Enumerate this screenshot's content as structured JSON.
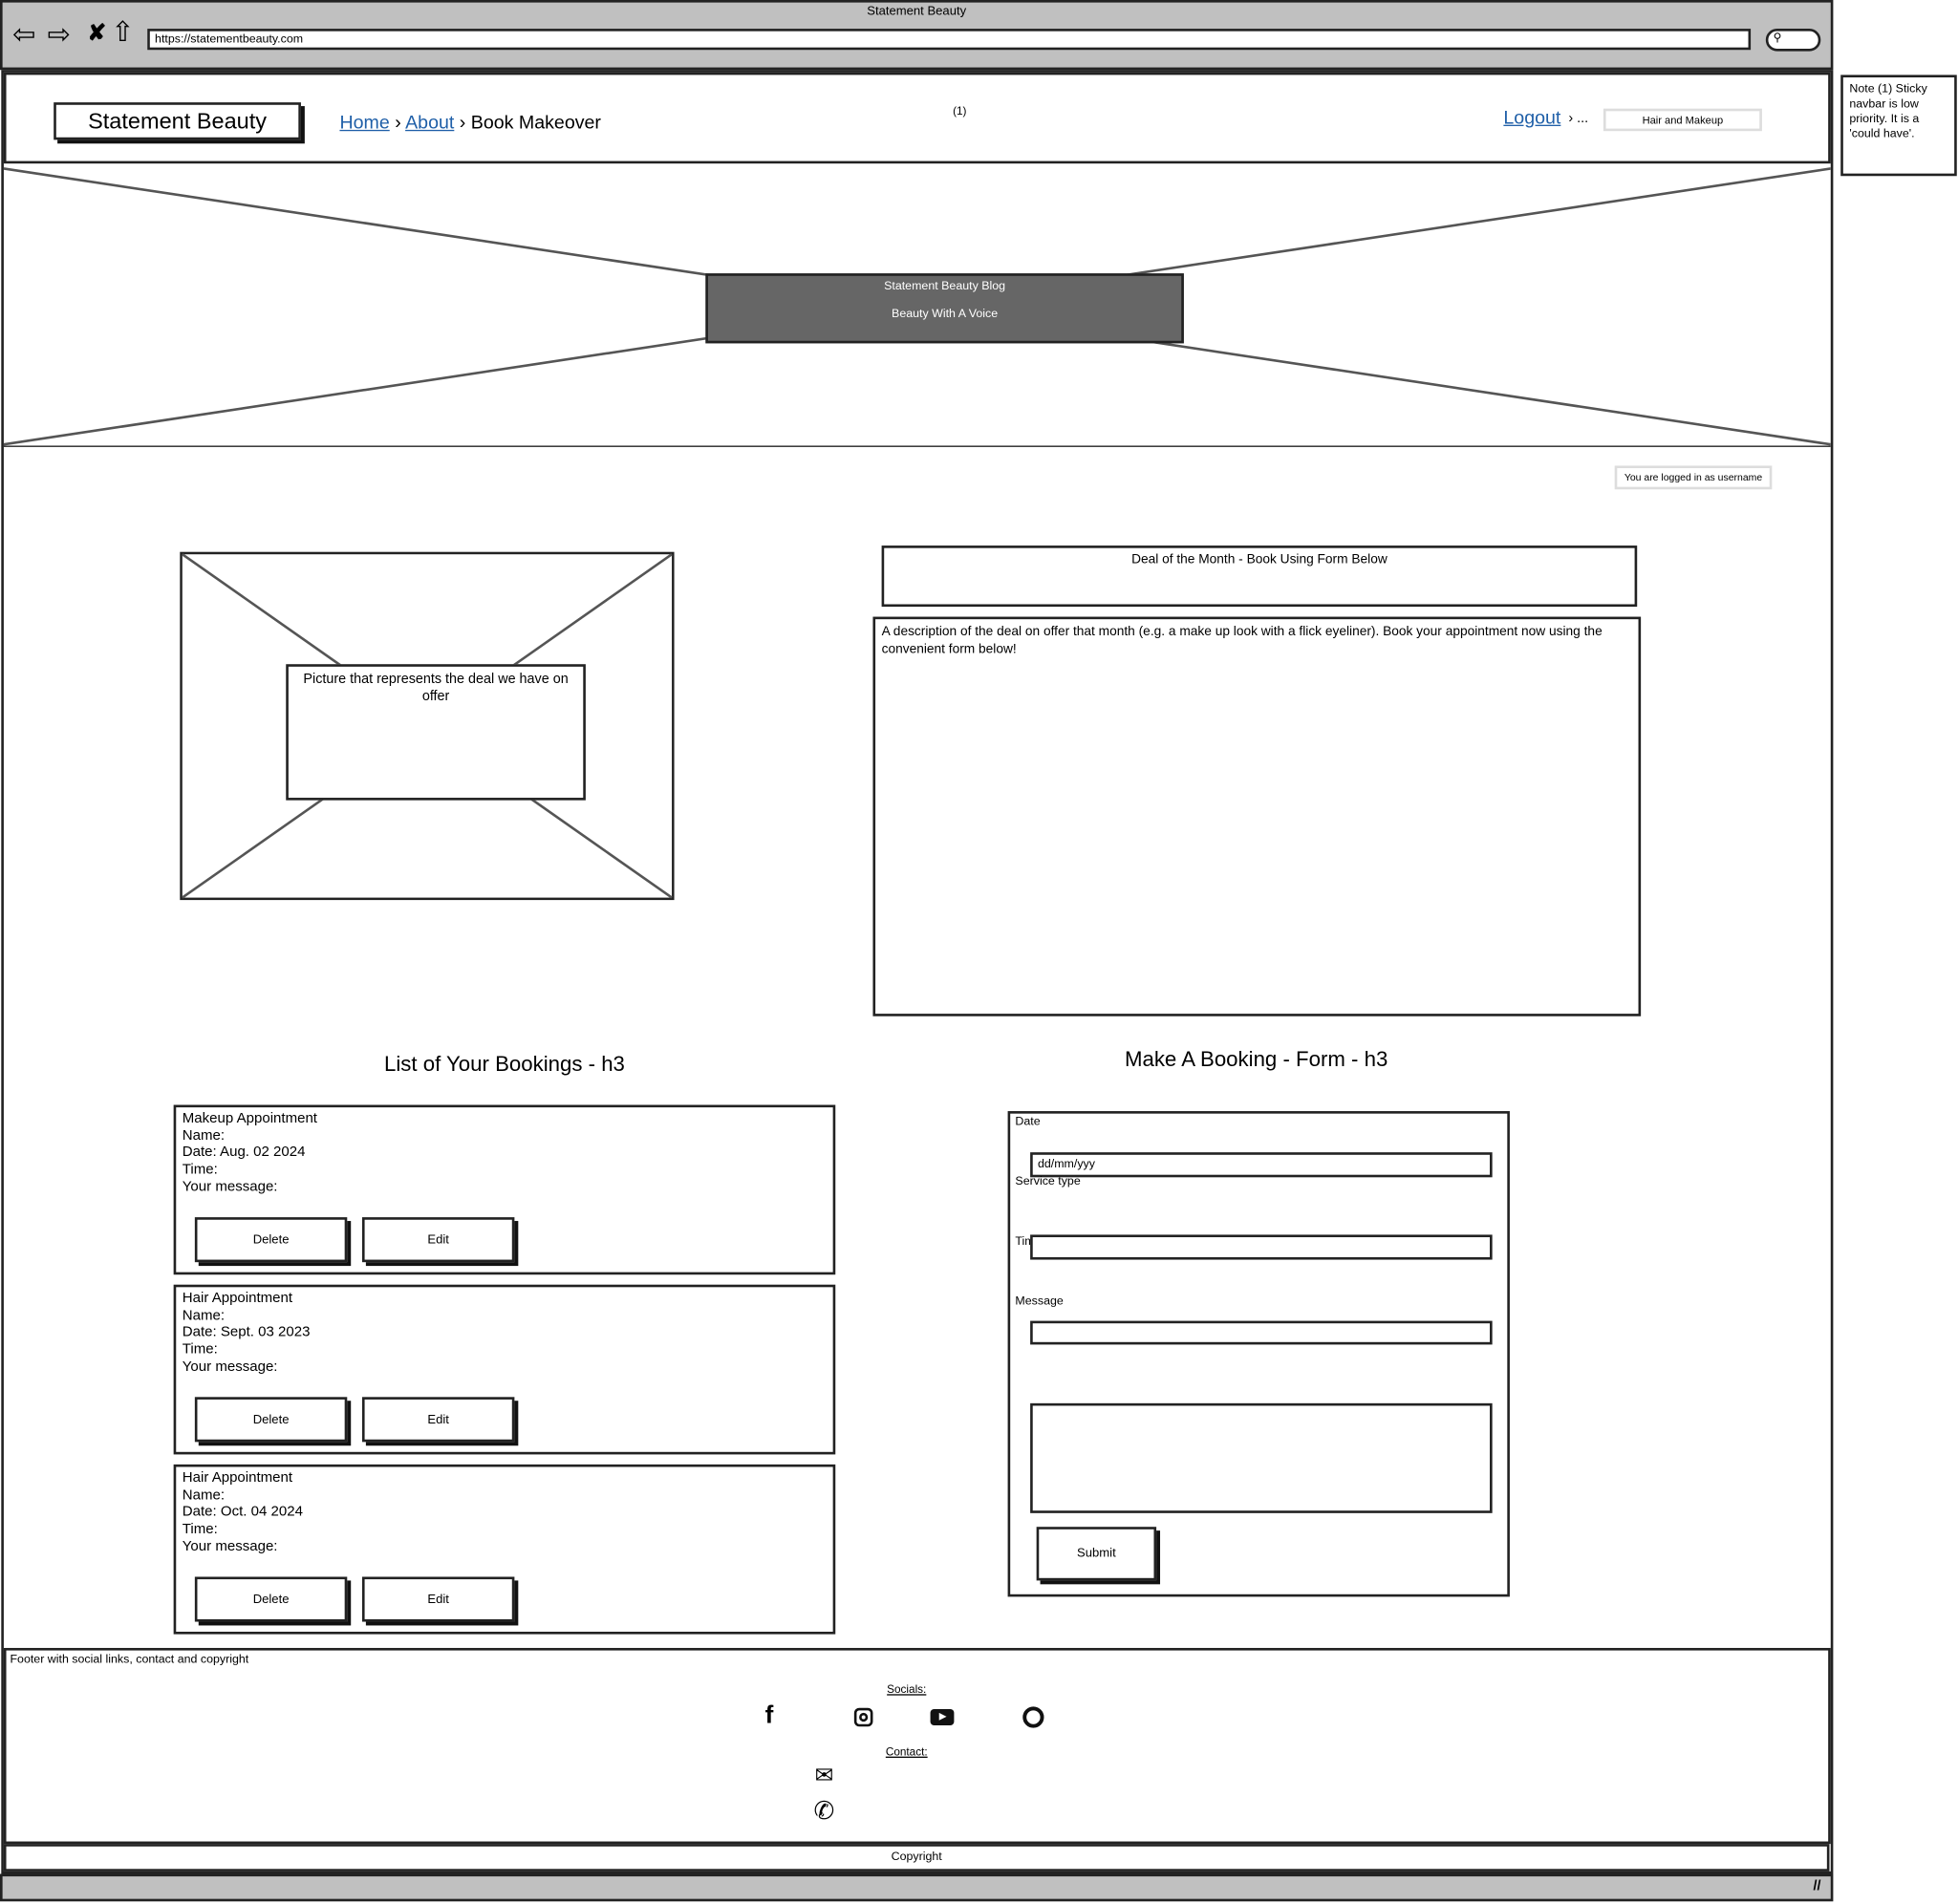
{
  "browser": {
    "title": "Statement Beauty",
    "url": "https://statementbeauty.com",
    "chrome_color": "#c0c0c0"
  },
  "navbar": {
    "logo": "Statement Beauty",
    "breadcrumb": [
      {
        "label": "Home"
      },
      {
        "label": "About"
      },
      {
        "label": "Book Makeover"
      }
    ],
    "note_marker": "(1)",
    "logout": "Logout",
    "ellipsis": "...",
    "hair_makeup": "Hair and Makeup",
    "link_color": "#1f5fa8"
  },
  "note": {
    "text": "Note (1) Sticky navbar is low priority. It is a 'could have'."
  },
  "hero": {
    "title": "Statement Beauty Blog",
    "subtitle": "Beauty With A Voice",
    "panel_color": "#666666"
  },
  "status": {
    "logged_in": "You are logged in as username"
  },
  "deal": {
    "image_caption": "Picture that represents the deal we have on offer",
    "title": "Deal of the Month - Book Using Form Below",
    "description": "A description of the deal on offer that month (e.g. a make up look with a flick eyeliner). Book your appointment now using the convenient form below!"
  },
  "bookings": {
    "heading": "List of Your Bookings - h3",
    "items": [
      {
        "type": "Makeup Appointment",
        "name": "Name:",
        "date": "Date: Aug. 02 2024",
        "time": "Time:",
        "message": "Your message:",
        "delete": "Delete",
        "edit": "Edit"
      },
      {
        "type": "Hair Appointment",
        "name": "Name:",
        "date": "Date: Sept. 03 2023",
        "time": "Time:",
        "message": "Your message:",
        "delete": "Delete",
        "edit": "Edit"
      },
      {
        "type": "Hair Appointment",
        "name": "Name:",
        "date": "Date: Oct. 04 2024",
        "time": "Time:",
        "message": "Your message:",
        "delete": "Delete",
        "edit": "Edit"
      }
    ]
  },
  "form": {
    "heading": "Make A Booking - Form - h3",
    "date_label": "Date",
    "date_placeholder": "dd/mm/yyy",
    "service_label": "Service type",
    "time_label": "Tim",
    "message_label": "Message",
    "submit": "Submit"
  },
  "footer": {
    "note": "Footer with social links, contact and copyright",
    "socials_label": "Socials:",
    "socials": [
      "facebook-icon",
      "instagram-icon",
      "youtube-icon",
      "github-icon"
    ],
    "contact_label": "Contact:",
    "contacts": [
      "envelope-icon",
      "phone-icon"
    ],
    "copyright": "Copyright"
  }
}
